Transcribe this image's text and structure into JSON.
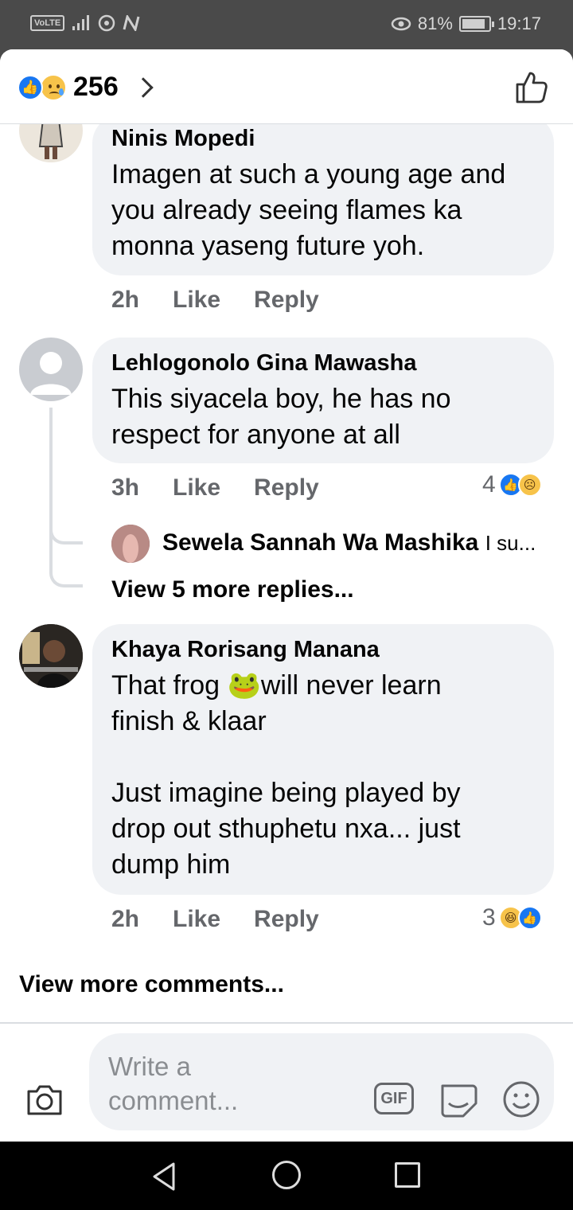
{
  "status_bar": {
    "volte": "VoLTE",
    "network_icons": [
      "signal-icon",
      "hotspot-icon",
      "nfc-icon"
    ],
    "eye_icon": "eye-comfort-icon",
    "battery": "81%",
    "time": "19:17"
  },
  "header": {
    "reaction_icons": [
      "like",
      "sad"
    ],
    "reaction_count": "256",
    "like_button_icon": "thumbs-up-icon"
  },
  "comments": [
    {
      "author": "Ninis Mopedi",
      "text": "Imagen at such a young age and you already seeing flames ka monna yaseng future yoh.",
      "time": "2h",
      "like_label": "Like",
      "reply_label": "Reply"
    },
    {
      "author": "Lehlogonolo Gina Mawasha",
      "text": "This siyacela boy, he has no respect for anyone at all",
      "time": "3h",
      "like_label": "Like",
      "reply_label": "Reply",
      "reaction_count": "4",
      "reaction_icons": [
        "like",
        "sad"
      ],
      "reply_preview": {
        "author": "Sewela Sannah Wa Mashika",
        "snippet": "I su..."
      },
      "view_more_replies": "View 5 more replies..."
    },
    {
      "author": "Khaya Rorisang Manana",
      "text_line1": "That frog 🐸will never learn\nfinish & klaar",
      "text_line2": "Just imagine being played by drop out sthuphetu nxa... just dump him",
      "time": "2h",
      "like_label": "Like",
      "reply_label": "Reply",
      "reaction_count": "3",
      "reaction_icons": [
        "haha",
        "like"
      ]
    }
  ],
  "view_more_comments": "View more comments...",
  "composer": {
    "placeholder": "Write a comment...",
    "gif_label": "GIF",
    "icons": [
      "camera-icon",
      "gif-icon",
      "sticker-icon",
      "emoji-icon"
    ]
  },
  "colors": {
    "like_blue": "#1877f2",
    "bubble_bg": "#f0f2f5",
    "meta_grey": "#65676b"
  }
}
